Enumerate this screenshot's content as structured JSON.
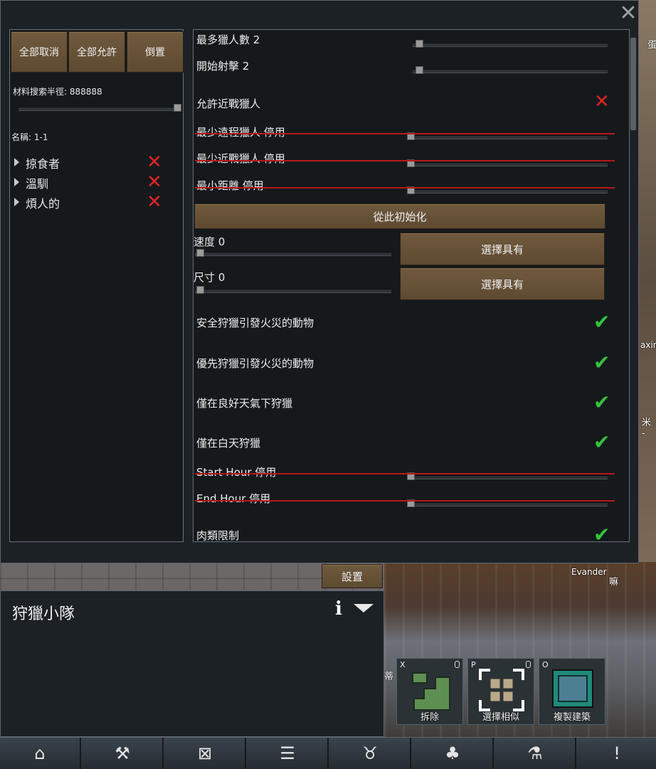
{
  "left_panel": {
    "buttons": [
      {
        "label": "全部取消"
      },
      {
        "label": "全部允許"
      },
      {
        "label": "倒置"
      }
    ],
    "search_radius_label": "材料搜索半徑: 888888",
    "search_radius_value": 1.0,
    "name_label": "名稱: 1-1",
    "tree_items": [
      {
        "label": "掠食者",
        "state": "disallowed",
        "icon": "x-icon"
      },
      {
        "label": "溫馴",
        "state": "disallowed",
        "icon": "x-icon"
      },
      {
        "label": "煩人的",
        "state": "disallowed",
        "icon": "x-icon"
      }
    ]
  },
  "right_panel": {
    "max_hunters_label": "最多獵人數 2",
    "start_shooting_label": "開始射擊 2",
    "allow_melee_label": "允許近戰獵人",
    "allow_melee_state": "disabled",
    "min_ranged_label": "最少遠程獵人 停用",
    "min_melee_label": "最少近戰獵人 停用",
    "min_distance_label": "最小距離 停用",
    "init_button_label": "從此初始化",
    "speed_label": "速度 0",
    "size_label": "尺寸 0",
    "select_with_label_1": "選擇具有",
    "select_with_label_2": "選擇具有",
    "checks": [
      {
        "label": "安全狩獵引發火災的動物",
        "state": "checked"
      },
      {
        "label": "優先狩獵引發火災的動物",
        "state": "checked"
      },
      {
        "label": "僅在良好天氣下狩獵",
        "state": "checked"
      },
      {
        "label": "僅在白天狩獵",
        "state": "checked"
      }
    ],
    "start_hour_label": "Start Hour 停用",
    "end_hour_label": "End Hour 停用",
    "meat_limit_label": "肉類限制",
    "meat_limit_state": "checked"
  },
  "settings_button_label": "設置",
  "info_panel": {
    "title": "狩獵小隊"
  },
  "gizmos": [
    {
      "key": "X",
      "label": "拆除"
    },
    {
      "key": "P",
      "label": "選擇相似"
    },
    {
      "key": "O",
      "label": "複製建築"
    }
  ],
  "map_labels": {
    "pawn_name": "Evander",
    "right_char_1": "蛋",
    "right_char_2": "axin",
    "right_char_3": "米 -",
    "mid_char": "嘛",
    "left_char": "蒂"
  },
  "bottom_bar_icons": [
    "home-icon",
    "hammer-icon",
    "zone-icon",
    "orders-icon",
    "animal-icon",
    "tree-icon",
    "flask-icon",
    "alert-icon"
  ],
  "colors": {
    "x_red": "#e02424",
    "check_green": "#33c23a",
    "button_brown": "#6a5438"
  }
}
